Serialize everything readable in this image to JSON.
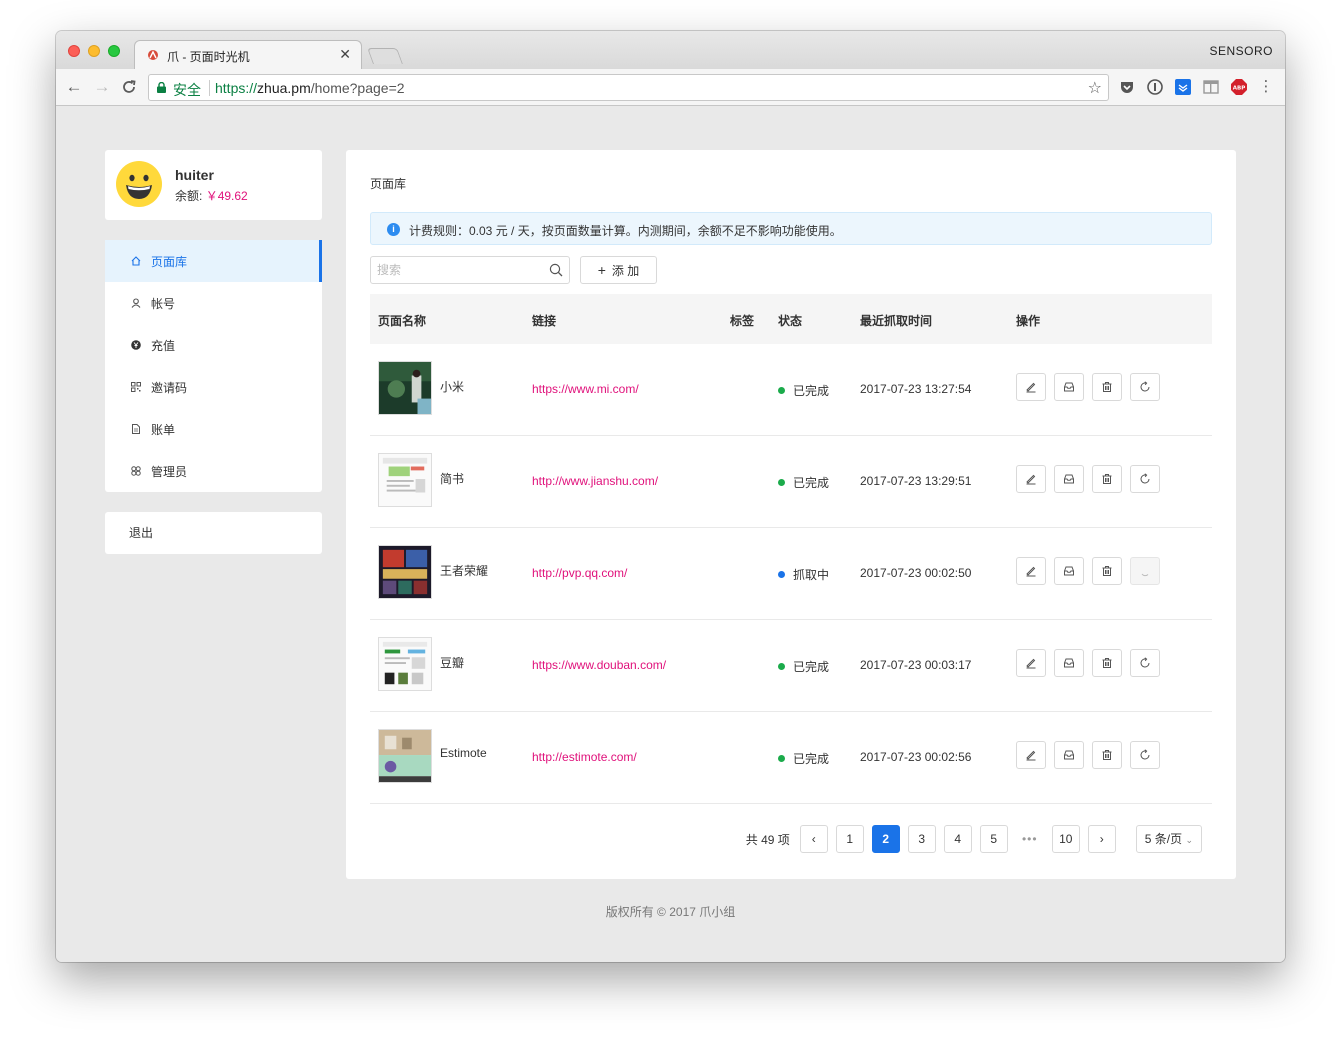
{
  "browser": {
    "tab_title": "爪 - 页面时光机",
    "close_symbol": "✕",
    "profile": "SENSORO",
    "secure_label": "安全",
    "url_scheme": "https://",
    "url_host": "zhua.pm",
    "url_path": "/home?page=2"
  },
  "user": {
    "name": "huiter",
    "balance_label": "余额:",
    "balance_value": "￥49.62"
  },
  "sidebar": {
    "items": [
      {
        "label": "页面库",
        "icon": "home-icon",
        "active": true
      },
      {
        "label": "帐号",
        "icon": "user-icon",
        "active": false
      },
      {
        "label": "充值",
        "icon": "yen-circle-icon",
        "active": false
      },
      {
        "label": "邀请码",
        "icon": "qrcode-icon",
        "active": false
      },
      {
        "label": "账单",
        "icon": "file-icon",
        "active": false
      },
      {
        "label": "管理员",
        "icon": "admin-icon",
        "active": false
      }
    ],
    "logout": "退出"
  },
  "main": {
    "breadcrumb": "页面库",
    "alert": "计费规则：0.03 元 / 天，按页面数量计算。内测期间，余额不足不影响功能使用。",
    "search_placeholder": "搜索",
    "add_label": "添 加",
    "columns": {
      "name": "页面名称",
      "link": "链接",
      "tags": "标签",
      "status": "状态",
      "time": "最近抓取时间",
      "ops": "操作"
    },
    "rows": [
      {
        "name": "小米",
        "url": "https://www.mi.com/",
        "status": "已完成",
        "status_color": "#1bab4b",
        "time": "2017-07-23 13:27:54",
        "refreshing": false
      },
      {
        "name": "简书",
        "url": "http://www.jianshu.com/",
        "status": "已完成",
        "status_color": "#1bab4b",
        "time": "2017-07-23 13:29:51",
        "refreshing": false
      },
      {
        "name": "王者荣耀",
        "url": "http://pvp.qq.com/",
        "status": "抓取中",
        "status_color": "#1a73e8",
        "time": "2017-07-23 00:02:50",
        "refreshing": true
      },
      {
        "name": "豆瓣",
        "url": "https://www.douban.com/",
        "status": "已完成",
        "status_color": "#1bab4b",
        "time": "2017-07-23 00:03:17",
        "refreshing": false
      },
      {
        "name": "Estimote",
        "url": "http://estimote.com/",
        "status": "已完成",
        "status_color": "#1bab4b",
        "time": "2017-07-23 00:02:56",
        "refreshing": false
      }
    ]
  },
  "pagination": {
    "total": "共 49 项",
    "prev": "‹",
    "pages": [
      "1",
      "2",
      "3",
      "4",
      "5"
    ],
    "current": "2",
    "ellipsis": "•••",
    "last": "10",
    "next": "›",
    "page_size": "5 条/页"
  },
  "footer": "版权所有 © 2017 爪小组",
  "colors": {
    "accent": "#1a73e8",
    "link": "#e0117b",
    "success": "#1bab4b"
  }
}
